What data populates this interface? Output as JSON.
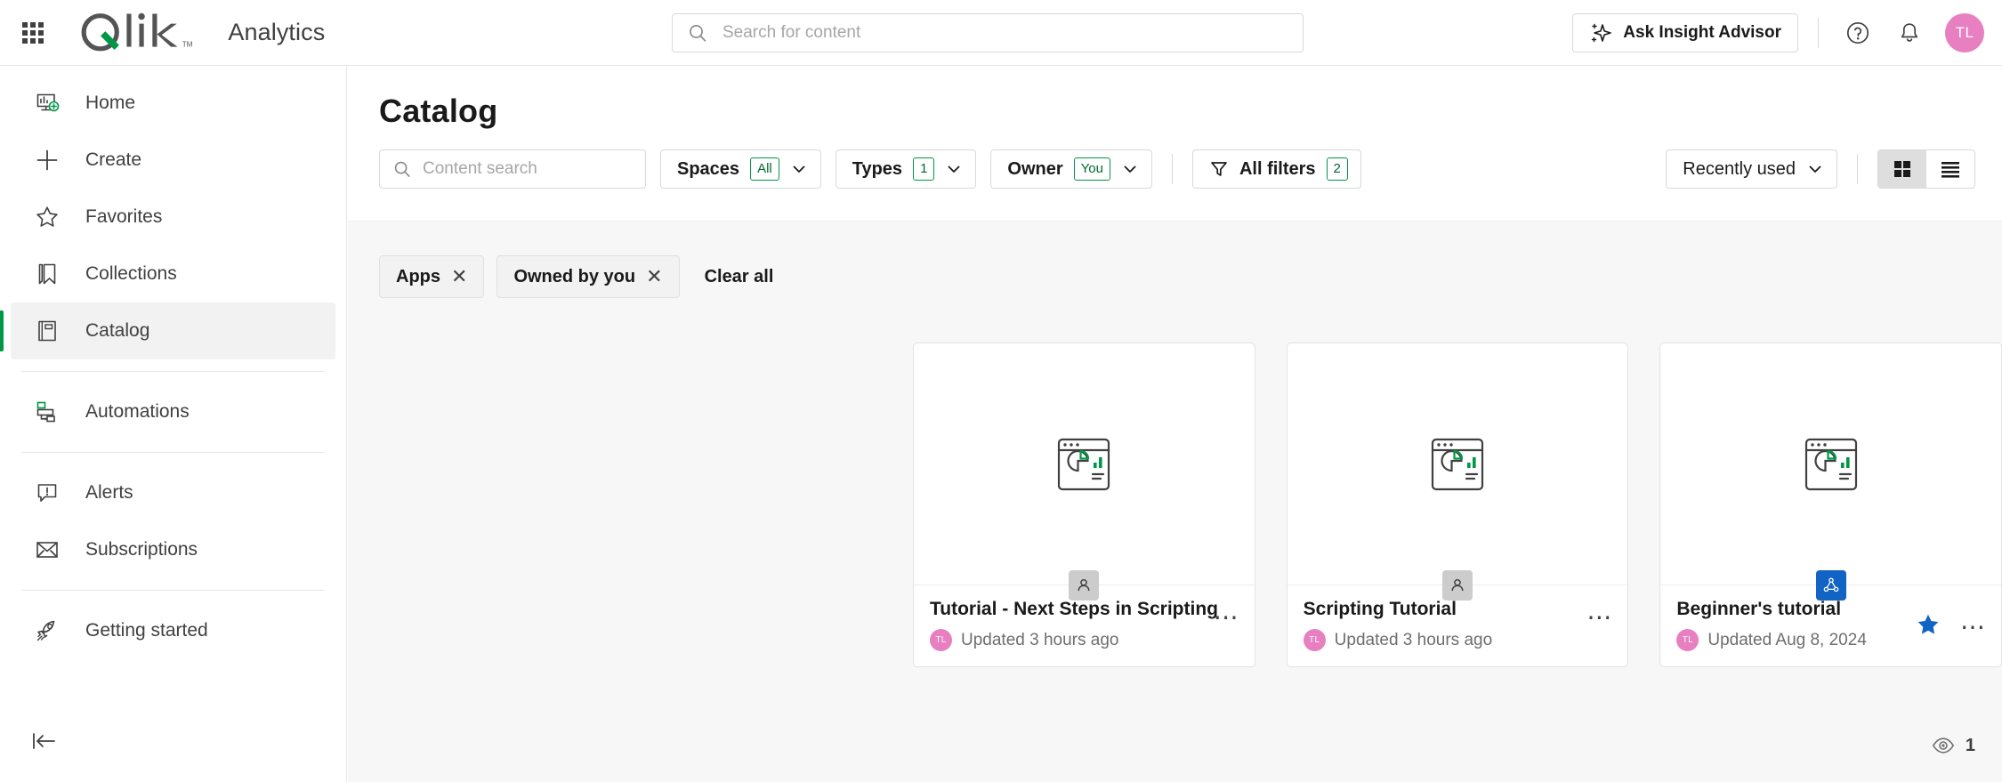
{
  "header": {
    "app_launcher_icon": "grid-apps-icon",
    "brand": "Qlik",
    "product": "Analytics",
    "search": {
      "placeholder": "Search for content",
      "value": "",
      "icon": "search-icon"
    },
    "ask_insight_advisor": "Ask Insight Advisor",
    "ask_icon": "sparkle-icon",
    "help_icon": "question-circle-icon",
    "notifications_icon": "bell-icon",
    "avatar_initials": "TL",
    "avatar_color": "#e87fc0"
  },
  "sidebar": {
    "items": [
      {
        "label": "Home",
        "icon": "home-dashboard-icon",
        "active": false
      },
      {
        "label": "Create",
        "icon": "plus-icon",
        "active": false
      },
      {
        "label": "Favorites",
        "icon": "star-outline-icon",
        "active": false
      },
      {
        "label": "Collections",
        "icon": "bookmark-icon",
        "active": false
      },
      {
        "label": "Catalog",
        "icon": "catalog-book-icon",
        "active": true
      },
      {
        "label": "Automations",
        "icon": "automation-flow-icon",
        "active": false
      },
      {
        "label": "Alerts",
        "icon": "alert-bubble-icon",
        "active": false
      },
      {
        "label": "Subscriptions",
        "icon": "envelope-icon",
        "active": false
      },
      {
        "label": "Getting started",
        "icon": "rocket-icon",
        "active": false
      }
    ],
    "active_accent_color": "#009845",
    "collapse_icon": "collapse-left-icon"
  },
  "main": {
    "page_title": "Catalog",
    "content_search": {
      "placeholder": "Content search",
      "value": "",
      "icon": "search-icon"
    },
    "filters": [
      {
        "label": "Spaces",
        "badge": "All",
        "icon": "chevron-down-icon"
      },
      {
        "label": "Types",
        "badge": "1",
        "icon": "chevron-down-icon"
      },
      {
        "label": "Owner",
        "badge": "You",
        "icon": "chevron-down-icon"
      }
    ],
    "all_filters": {
      "label": "All filters",
      "badge": "2",
      "icon": "funnel-icon"
    },
    "sort": {
      "label": "Recently used",
      "icon": "chevron-down-icon"
    },
    "view_modes": [
      {
        "name": "grid-view",
        "icon": "grid-view-icon",
        "selected": true
      },
      {
        "name": "list-view",
        "icon": "list-view-icon",
        "selected": false
      }
    ],
    "chips": [
      {
        "label": "Apps",
        "remove_icon": "close-icon"
      },
      {
        "label": "Owned by you",
        "remove_icon": "close-icon"
      }
    ],
    "clear_all": "Clear all",
    "cards": [
      {
        "title": "Tutorial - Next Steps in Scripting",
        "updated": "Updated 3 hours ago",
        "owner_initials": "TL",
        "thumb_icon": "app-chart-icon",
        "space_type": "personal",
        "space_icon": "person-icon",
        "favorite": false,
        "kebab_icon": "more-options-icon"
      },
      {
        "title": "Scripting Tutorial",
        "updated": "Updated 3 hours ago",
        "owner_initials": "TL",
        "thumb_icon": "app-chart-icon",
        "space_type": "personal",
        "space_icon": "person-icon",
        "favorite": false,
        "kebab_icon": "more-options-icon"
      },
      {
        "title": "Beginner's tutorial",
        "updated": "Updated Aug 8, 2024",
        "owner_initials": "TL",
        "thumb_icon": "app-chart-icon",
        "space_type": "shared",
        "space_icon": "shared-space-icon",
        "favorite": true,
        "kebab_icon": "more-options-icon"
      }
    ],
    "count": {
      "icon": "eye-icon",
      "value": "1"
    }
  },
  "colors": {
    "brand_green": "#009845",
    "accent_blue": "#1163c4",
    "avatar_pink": "#e87fc0",
    "page_bg": "#f7f7f7"
  }
}
